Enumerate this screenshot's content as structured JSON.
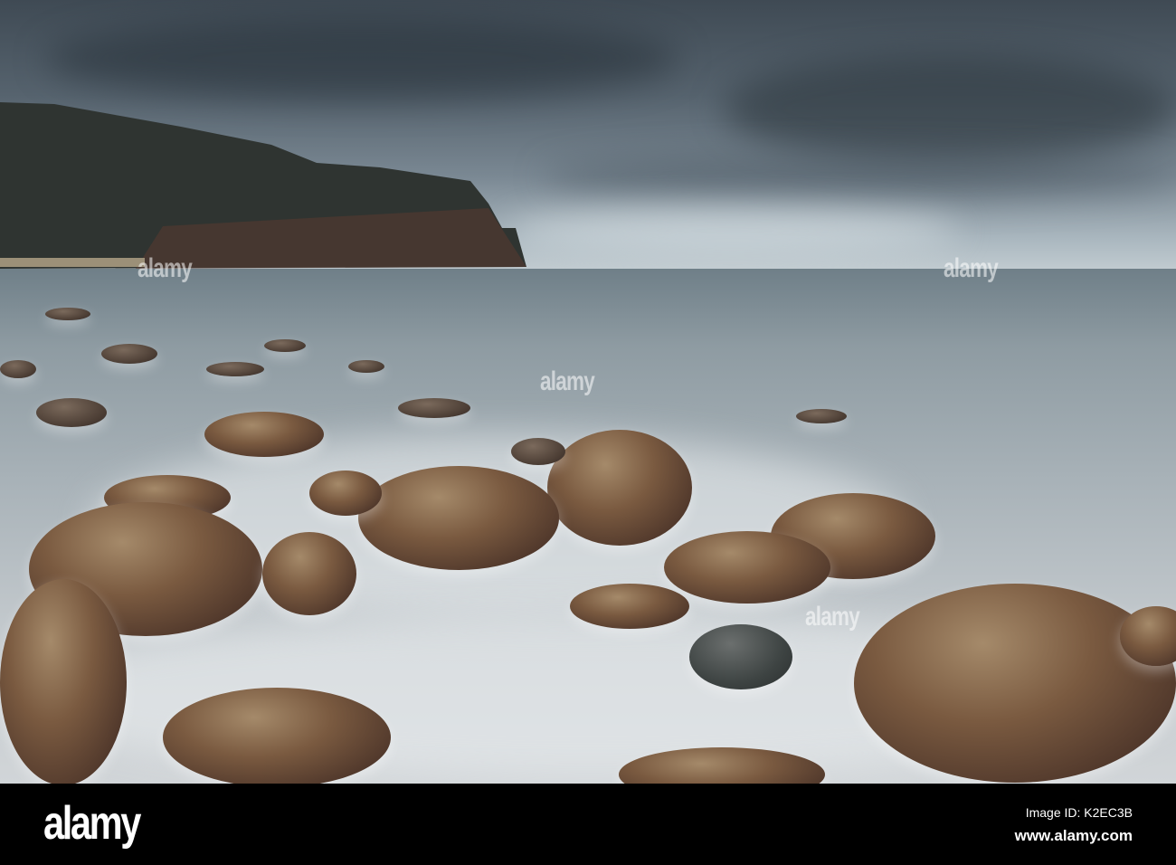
{
  "photo": {
    "subject": "boulder beach with long-exposure sea mist below coastal cliffs",
    "watermark_text": "alamy"
  },
  "footer": {
    "logo": "alamy",
    "image_id": "Image ID: K2EC3B",
    "url": "www.alamy.com"
  }
}
